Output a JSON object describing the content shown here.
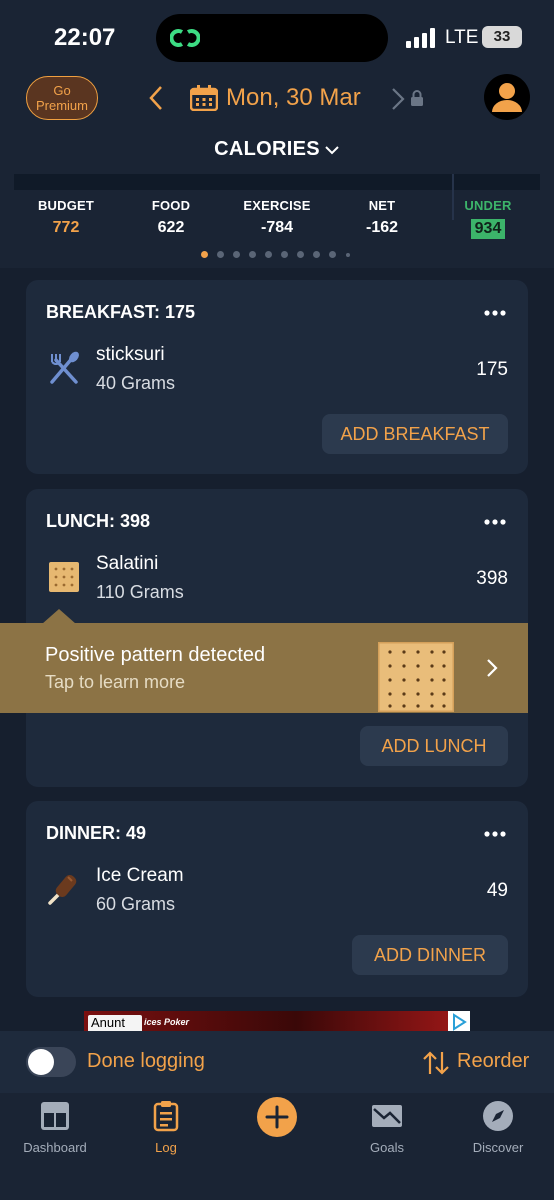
{
  "status_bar": {
    "time": "22:07",
    "network": "LTE",
    "battery": "33"
  },
  "header": {
    "premium_label_1": "Go",
    "premium_label_2": "Premium",
    "date": "Mon, 30 Mar",
    "section_title": "CALORIES"
  },
  "summary": [
    {
      "label": "BUDGET",
      "value": "772",
      "color": "#f2a24a"
    },
    {
      "label": "FOOD",
      "value": "622",
      "color": "#ffffff"
    },
    {
      "label": "EXERCISE",
      "value": "-784",
      "color": "#ffffff"
    },
    {
      "label": "NET",
      "value": "-162",
      "color": "#ffffff"
    },
    {
      "label": "UNDER",
      "value": "934",
      "color": "#3cb46a"
    }
  ],
  "page_indicator": {
    "pages": 10,
    "active": 1
  },
  "meals": {
    "breakfast": {
      "title": "BREAKFAST: 175",
      "food": "sticksuri",
      "qty": "40 Grams",
      "cal": "175",
      "add_label": "ADD BREAKFAST"
    },
    "lunch": {
      "title": "LUNCH: 398",
      "food": "Salatini",
      "qty": "110 Grams",
      "cal": "398",
      "add_label": "ADD LUNCH"
    },
    "dinner": {
      "title": "DINNER: 49",
      "food": "Ice Cream",
      "qty": "60 Grams",
      "cal": "49",
      "add_label": "ADD DINNER"
    }
  },
  "insight": {
    "title": "Positive pattern detected",
    "subtitle": "Tap to learn more"
  },
  "ad": {
    "badge": "Anunt",
    "text": "ices Poker"
  },
  "logging": {
    "done_label": "Done logging",
    "reorder_label": "Reorder",
    "done": false
  },
  "tabs": [
    {
      "label": "Dashboard",
      "icon": "dashboard-icon"
    },
    {
      "label": "Log",
      "icon": "log-icon",
      "active": true
    },
    {
      "label": "",
      "icon": "add-icon"
    },
    {
      "label": "Goals",
      "icon": "goals-icon"
    },
    {
      "label": "Discover",
      "icon": "discover-icon"
    }
  ],
  "colors": {
    "accent": "#f2a24a",
    "background": "#1a2434",
    "card": "#1e2a3c",
    "under": "#3cb46a",
    "insight": "#8c7345"
  }
}
